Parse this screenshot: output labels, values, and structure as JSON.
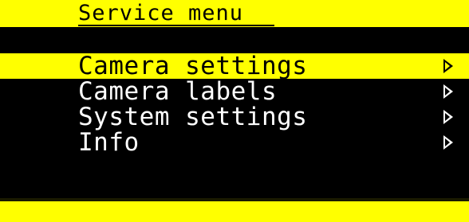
{
  "header": {
    "title": "Service menu"
  },
  "menu": {
    "items": [
      {
        "label": "Camera settings",
        "icon": "arrow-right-icon",
        "selected": true
      },
      {
        "label": "Camera labels",
        "icon": "arrow-right-icon",
        "selected": false
      },
      {
        "label": "System settings",
        "icon": "arrow-right-icon",
        "selected": false
      },
      {
        "label": "Info",
        "icon": "arrow-right-icon",
        "selected": false
      }
    ]
  },
  "colors": {
    "background": "#000000",
    "accent": "#ffff00",
    "text": "#ffffff",
    "selected_text": "#000000"
  }
}
